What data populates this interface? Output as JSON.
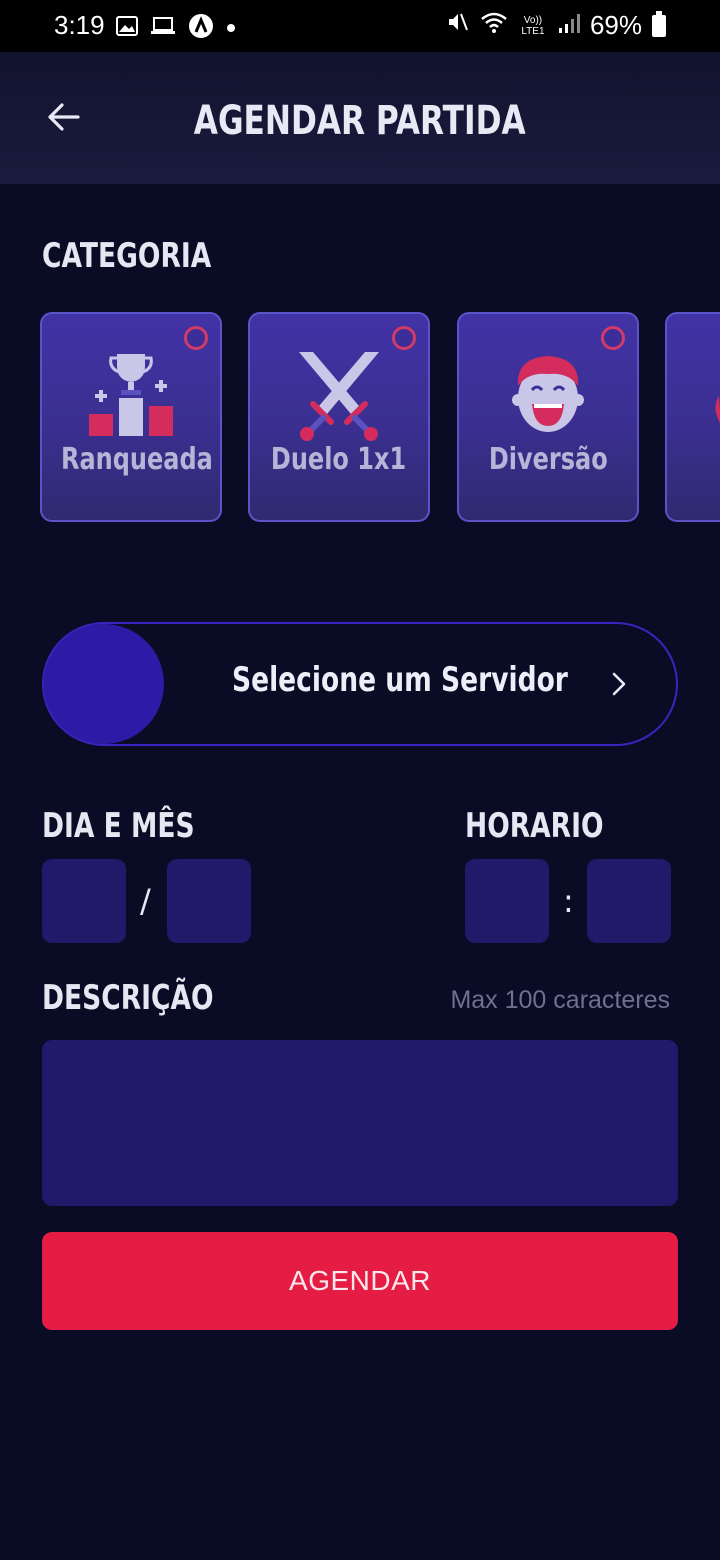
{
  "status_bar": {
    "time": "3:19",
    "battery": "69%",
    "left_icons": [
      "image-icon",
      "laptop-icon",
      "a-circle-icon",
      "dot-icon"
    ],
    "right_icons": [
      "mute-icon",
      "wifi-icon",
      "volte-icon",
      "signal-icon",
      "battery-icon"
    ],
    "volte_text": "Vo)) LTE1"
  },
  "header": {
    "title": "AGENDAR PARTIDA",
    "back_icon": "arrow-left-icon"
  },
  "category": {
    "label": "CATEGORIA",
    "items": [
      {
        "label": "Ranqueada",
        "icon": "trophy-podium-icon"
      },
      {
        "label": "Duelo 1x1",
        "icon": "crossed-swords-icon"
      },
      {
        "label": "Diversão",
        "icon": "laughing-face-icon"
      },
      {
        "label": "",
        "icon": "partial-card-icon"
      }
    ]
  },
  "server": {
    "label": "Selecione um Servidor",
    "chevron_icon": "chevron-right-icon"
  },
  "date": {
    "label": "DIA E MÊS",
    "separator": "/"
  },
  "time": {
    "label": "HORARIO",
    "separator": ":"
  },
  "description": {
    "label": "DESCRIÇÃO",
    "hint": "Max 100 caracteres"
  },
  "submit": {
    "label": "AGENDAR"
  },
  "colors": {
    "background": "#0a0b24",
    "accent": "#e51d45",
    "input_bg": "#21196a",
    "card_bg": "#4233a6"
  }
}
